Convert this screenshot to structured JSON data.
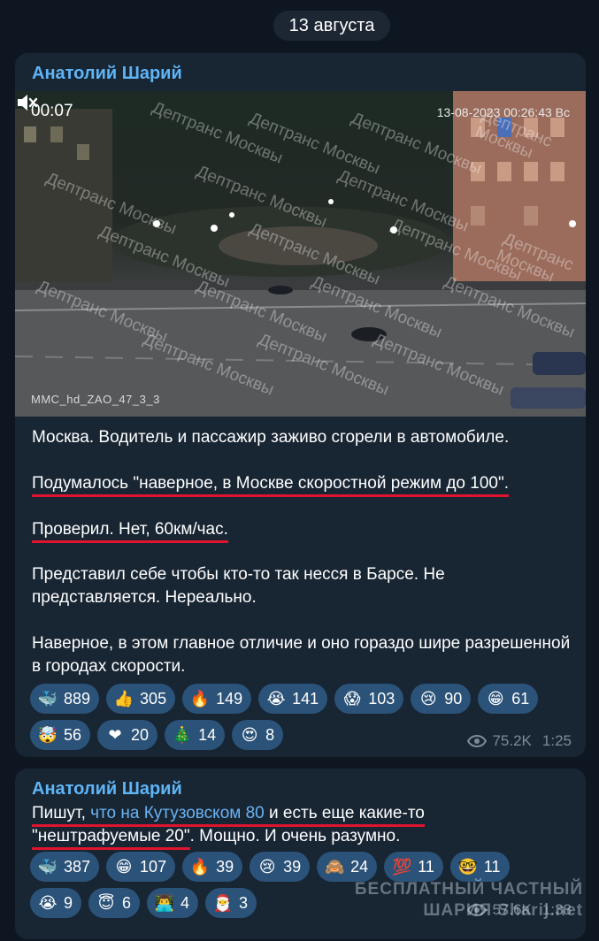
{
  "date_label": "13 августа",
  "post1": {
    "author": "Анатолий Шарий",
    "video": {
      "time": "00:07",
      "timestamp": "13-08-2023 00:26:43 Вс",
      "camera_id": "MMC_hd_ZAO_47_3_3",
      "watermark": "Дептранс Москвы"
    },
    "text": {
      "p1": "Москва. Водитель и пассажир заживо сгорели в автомобиле.",
      "p2": "Подумалось \"наверное, в Москве скоростной режим до 100\".",
      "p3": "Проверил. Нет, 60км/час.",
      "p4": "Представил себе чтобы кто-то так несся в Барсе. Не представляется. Нереально.",
      "p5": "Наверное, в этом главное отличие и оно гораздо шире разрешенной в городах скорости."
    },
    "reactions": [
      {
        "emoji": "🐳",
        "count": "889"
      },
      {
        "emoji": "👍",
        "count": "305"
      },
      {
        "emoji": "🔥",
        "count": "149"
      },
      {
        "emoji": "😭",
        "count": "141"
      },
      {
        "emoji": "😱",
        "count": "103"
      },
      {
        "emoji": "😢",
        "count": "90"
      },
      {
        "emoji": "😁",
        "count": "61"
      },
      {
        "emoji": "🤯",
        "count": "56"
      },
      {
        "emoji": "❤",
        "count": "20"
      },
      {
        "emoji": "🎄",
        "count": "14"
      },
      {
        "emoji": "😍",
        "count": "8"
      }
    ],
    "views": "75.2K",
    "time": "1:25"
  },
  "post2": {
    "author": "Анатолий Шарий",
    "text": {
      "part1": "Пишут, ",
      "link": "что на Кутузовском 80",
      "part2": " и есть еще какие-то",
      "line2a": "\"нештрафуемые 20\"",
      "line2b": ". Мощно. И очень разумно."
    },
    "reactions": [
      {
        "emoji": "🐳",
        "count": "387"
      },
      {
        "emoji": "😁",
        "count": "107"
      },
      {
        "emoji": "🔥",
        "count": "39"
      },
      {
        "emoji": "😢",
        "count": "39"
      },
      {
        "emoji": "🙈",
        "count": "24"
      },
      {
        "emoji": "💯",
        "count": "11"
      },
      {
        "emoji": "🤓",
        "count": "11"
      },
      {
        "emoji": "😭",
        "count": "9"
      },
      {
        "emoji": "😇",
        "count": "6"
      },
      {
        "emoji": "👨‍💻",
        "count": "4"
      },
      {
        "emoji": "🎅",
        "count": "3"
      }
    ],
    "views": "57.6K",
    "time": "1:38"
  },
  "site_watermark": {
    "line1": "БЕСПЛАТНЫЙ ЧАСТНЫЙ",
    "line2": "ШАРИЯ Sharij.net"
  }
}
